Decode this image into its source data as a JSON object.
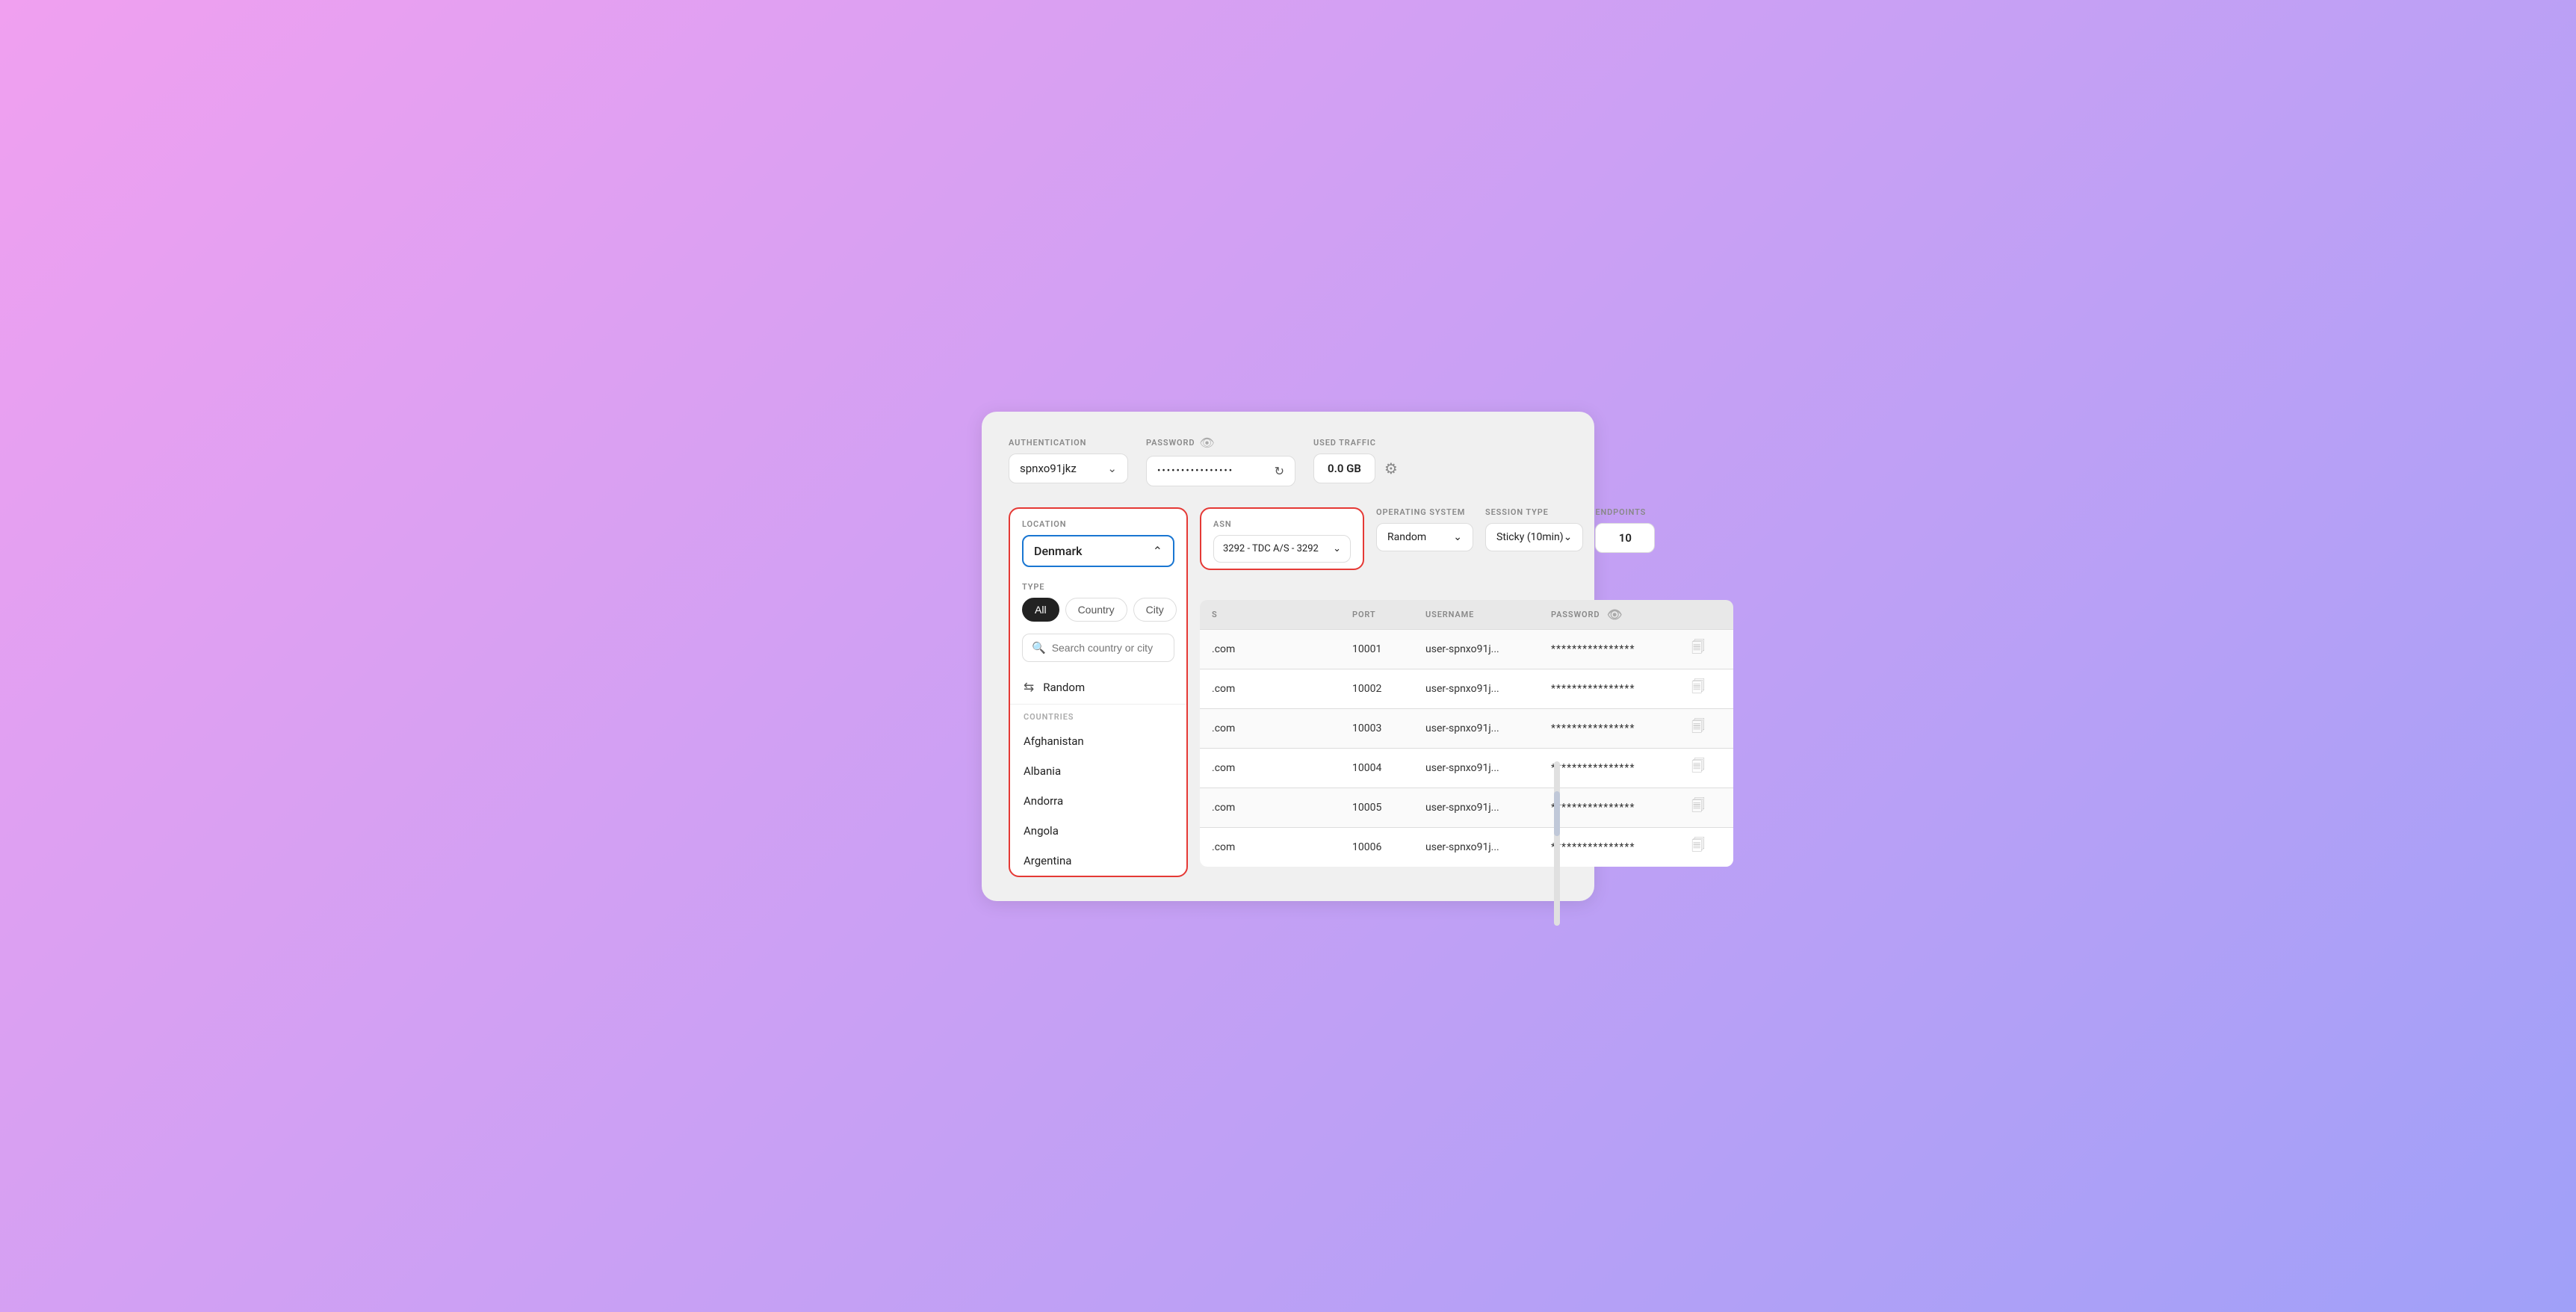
{
  "topbar": {
    "auth_label": "AUTHENTICATION",
    "auth_value": "spnxo91jkz",
    "password_label": "PASSWORD",
    "password_value": "••••••••••••••••",
    "traffic_label": "USED TRAFFIC",
    "traffic_value": "0.0 GB"
  },
  "filters": {
    "location_label": "LOCATION",
    "location_value": "Denmark",
    "asn_label": "ASN",
    "asn_value": "3292 - TDC A/S - 3292",
    "os_label": "OPERATING SYSTEM",
    "os_value": "Random",
    "session_label": "SESSION TYPE",
    "session_value": "Sticky (10min)",
    "endpoints_label": "ENDPOINTS",
    "endpoints_value": "10"
  },
  "type_selector": {
    "label": "TYPE",
    "options": [
      "All",
      "Country",
      "City"
    ],
    "active": "All"
  },
  "search": {
    "placeholder": "Search country or city"
  },
  "random_item": {
    "label": "Random"
  },
  "countries_section": {
    "label": "COUNTRIES",
    "items": [
      "Afghanistan",
      "Albania",
      "Andorra",
      "Angola",
      "Argentina"
    ]
  },
  "table": {
    "headers": [
      "S",
      "PORT",
      "USERNAME",
      "PASSWORD",
      ""
    ],
    "rows": [
      {
        "server": ".com",
        "port": "10001",
        "username": "user-spnxo91j...",
        "password": "****************"
      },
      {
        "server": ".com",
        "port": "10002",
        "username": "user-spnxo91j...",
        "password": "****************"
      },
      {
        "server": ".com",
        "port": "10003",
        "username": "user-spnxo91j...",
        "password": "****************"
      },
      {
        "server": ".com",
        "port": "10004",
        "username": "user-spnxo91j...",
        "password": "****************"
      },
      {
        "server": ".com",
        "port": "10005",
        "username": "user-spnxo91j...",
        "password": "****************"
      },
      {
        "server": ".com",
        "port": "10006",
        "username": "user-spnxo91j...",
        "password": "****************"
      }
    ]
  }
}
